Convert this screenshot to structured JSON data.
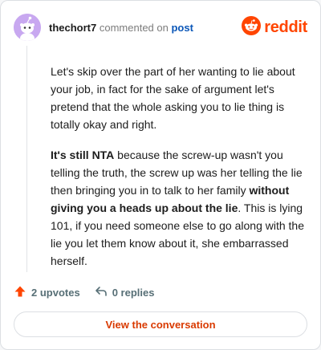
{
  "comment": {
    "username": "thechort7",
    "commented_on_text": "commented on",
    "post_link_text": "post",
    "paragraphs": [
      [
        {
          "text": "Let's skip over the part of her wanting to lie about your job, in fact for the sake of argument let's pretend that the whole asking you to lie thing is totally okay and right.",
          "bold": false
        }
      ],
      [
        {
          "text": "It's still NTA",
          "bold": true
        },
        {
          "text": " because the screw-up wasn't you telling the truth, the screw up was her telling the lie then bringing you in to talk to her family ",
          "bold": false
        },
        {
          "text": "without giving you a heads up about the lie",
          "bold": true
        },
        {
          "text": ". This is lying 101, if you need someone else to go along with the lie you let them know about it, she embarrassed herself.",
          "bold": false
        }
      ]
    ]
  },
  "brand": {
    "wordmark": "reddit",
    "color": "#ff4500"
  },
  "actions": {
    "upvotes": "2 upvotes",
    "replies": "0 replies"
  },
  "cta": {
    "label": "View the conversation"
  },
  "icons": {
    "avatar": "snoo-avatar-icon",
    "logo": "reddit-logo-icon",
    "upvote": "upvote-arrow-icon",
    "reply": "reply-arrow-icon"
  },
  "colors": {
    "accent": "#ff4500",
    "link": "#0b57b8",
    "cta_text": "#d93a00",
    "avatar_bg": "#c8a8f0"
  }
}
